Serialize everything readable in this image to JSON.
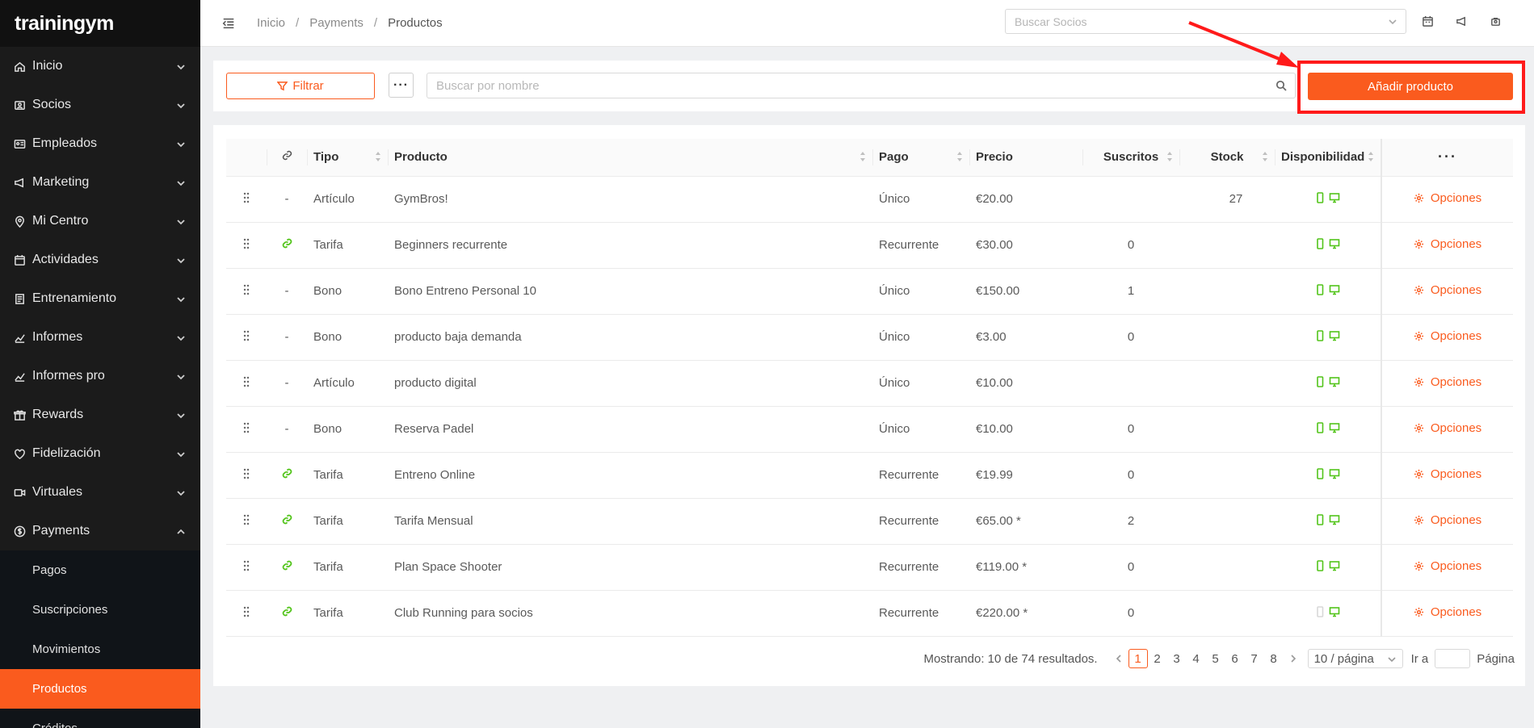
{
  "brand": {
    "name": "trainingym"
  },
  "sidebar": {
    "items": [
      {
        "label": "Inicio",
        "icon": "home-icon"
      },
      {
        "label": "Socios",
        "icon": "members-icon"
      },
      {
        "label": "Empleados",
        "icon": "id-card-icon"
      },
      {
        "label": "Marketing",
        "icon": "megaphone-icon"
      },
      {
        "label": "Mi Centro",
        "icon": "location-icon"
      },
      {
        "label": "Actividades",
        "icon": "calendar-icon"
      },
      {
        "label": "Entrenamiento",
        "icon": "training-icon"
      },
      {
        "label": "Informes",
        "icon": "chart-icon"
      },
      {
        "label": "Informes pro",
        "icon": "chart-icon"
      },
      {
        "label": "Rewards",
        "icon": "gift-icon"
      },
      {
        "label": "Fidelización",
        "icon": "heart-icon"
      },
      {
        "label": "Virtuales",
        "icon": "video-icon"
      },
      {
        "label": "Payments",
        "icon": "dollar-icon"
      }
    ],
    "payments_sub": [
      "Pagos",
      "Suscripciones",
      "Movimientos",
      "Productos",
      "Créditos"
    ]
  },
  "header": {
    "breadcrumb": [
      "Inicio",
      "Payments",
      "Productos"
    ],
    "member_search_placeholder": "Buscar Socios"
  },
  "toolbar": {
    "filter_label": "Filtrar",
    "more_label": "···",
    "name_search_placeholder": "Buscar por nombre",
    "add_label": "Añadir producto"
  },
  "table": {
    "headers": {
      "tipo": "Tipo",
      "producto": "Producto",
      "pago": "Pago",
      "precio": "Precio",
      "suscritos": "Suscritos",
      "stock": "Stock",
      "disponibilidad": "Disponibilidad",
      "more": "···"
    },
    "options_label": "Opciones",
    "rows": [
      {
        "link": "-",
        "tipo": "Artículo",
        "producto": "GymBros!",
        "pago": "Único",
        "precio": "€20.00",
        "suscritos": "",
        "stock": "27",
        "mobile": true
      },
      {
        "link": "link",
        "tipo": "Tarifa",
        "producto": "Beginners recurrente",
        "pago": "Recurrente",
        "precio": "€30.00",
        "suscritos": "0",
        "stock": "",
        "mobile": true
      },
      {
        "link": "-",
        "tipo": "Bono",
        "producto": "Bono Entreno Personal 10",
        "pago": "Único",
        "precio": "€150.00",
        "suscritos": "1",
        "stock": "",
        "mobile": true
      },
      {
        "link": "-",
        "tipo": "Bono",
        "producto": "producto baja demanda",
        "pago": "Único",
        "precio": "€3.00",
        "suscritos": "0",
        "stock": "",
        "mobile": true
      },
      {
        "link": "-",
        "tipo": "Artículo",
        "producto": "producto digital",
        "pago": "Único",
        "precio": "€10.00",
        "suscritos": "",
        "stock": "",
        "mobile": true
      },
      {
        "link": "-",
        "tipo": "Bono",
        "producto": "Reserva Padel",
        "pago": "Único",
        "precio": "€10.00",
        "suscritos": "0",
        "stock": "",
        "mobile": true
      },
      {
        "link": "link",
        "tipo": "Tarifa",
        "producto": "Entreno Online",
        "pago": "Recurrente",
        "precio": "€19.99",
        "suscritos": "0",
        "stock": "",
        "mobile": true
      },
      {
        "link": "link",
        "tipo": "Tarifa",
        "producto": "Tarifa Mensual",
        "pago": "Recurrente",
        "precio": "€65.00 *",
        "suscritos": "2",
        "stock": "",
        "mobile": true
      },
      {
        "link": "link",
        "tipo": "Tarifa",
        "producto": "Plan Space Shooter",
        "pago": "Recurrente",
        "precio": "€119.00 *",
        "suscritos": "0",
        "stock": "",
        "mobile": true
      },
      {
        "link": "link",
        "tipo": "Tarifa",
        "producto": "Club Running para socios",
        "pago": "Recurrente",
        "precio": "€220.00 *",
        "suscritos": "0",
        "stock": "",
        "mobile": false
      }
    ]
  },
  "pagination": {
    "total_text": "Mostrando: 10 de 74 resultados.",
    "pages": [
      "1",
      "2",
      "3",
      "4",
      "5",
      "6",
      "7",
      "8"
    ],
    "current": "1",
    "page_size": "10 / página",
    "goto_label": "Ir a",
    "page_label": "Página"
  },
  "colors": {
    "accent": "#fa5b1e",
    "sidebar_bg": "#1b1b1b",
    "available_green": "#52c41a",
    "highlight_red": "#ff1a1a"
  }
}
